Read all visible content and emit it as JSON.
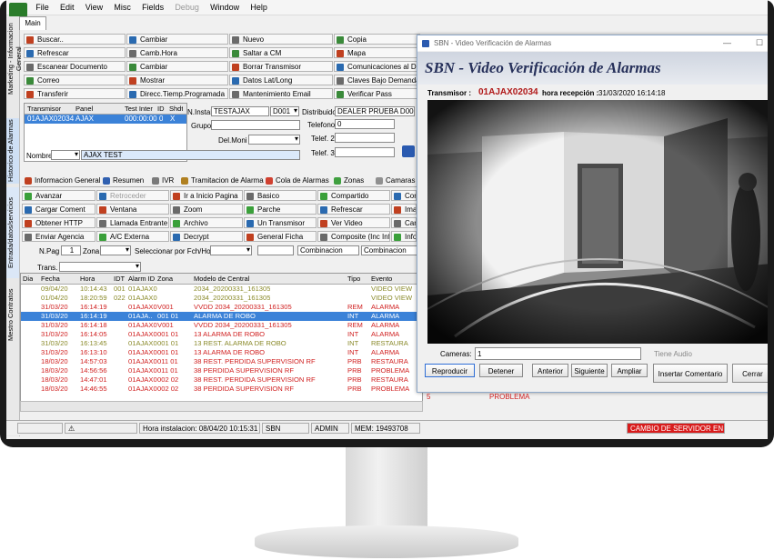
{
  "menu": {
    "items": [
      "File",
      "Edit",
      "View",
      "Misc",
      "Fields",
      "Debug",
      "Window",
      "Help"
    ],
    "disabled": [
      "Debug"
    ]
  },
  "main_tab": "Main",
  "vertical_tabs": [
    "Marketing - Informacion General",
    "Historico de Alarmas",
    "Entrada/datos/servicios",
    "Mestro Contratos"
  ],
  "toolbar": [
    [
      "Buscar..",
      "Cambiar",
      "Nuevo",
      "Copia"
    ],
    [
      "Refrescar",
      "Camb.Hora",
      "Saltar a CM",
      "Mapa"
    ],
    [
      "Escanear Documento",
      "Cambiar",
      "Borrar Transmisor",
      "Comunicaciones al Di"
    ],
    [
      "Correo",
      "Mostrar",
      "Datos Lat/Long",
      "Claves Bajo Demanda"
    ],
    [
      "Transferir",
      "Direcc.Tiemp.Programada",
      "Mantenimiento Email",
      "Verificar Pass"
    ]
  ],
  "transmitter_grid": {
    "headers": [
      "Transmisor",
      "Panel",
      "Test Inter",
      "ID",
      "Shdt"
    ],
    "row": [
      "01AJAX02034",
      "AJAX",
      "000:00:00",
      "0",
      "X"
    ]
  },
  "form": {
    "n_instal_label": "N.Instal",
    "n_instal_value": "TESTAJAX",
    "d_value": "D001",
    "distribuidor_label": "Distribuidor",
    "distribuidor_value": "DEALER PRUEBA D0001",
    "grupo_label": "Grupo",
    "telefono_label": "Telefono",
    "telefono_value": "0",
    "delmon_label": "Del.Moni",
    "telef2_label": "Telef. 2",
    "telef3_label": "Telef. 3",
    "nombre_label": "Nombre",
    "nombre_value": "AJAX TEST"
  },
  "subtabs": [
    "Informacion General",
    "Resumen",
    "IVR",
    "Tramitacion de Alarma",
    "Cola de Alarmas",
    "Zonas",
    "Camaras"
  ],
  "actions": [
    [
      "Avanzar",
      "Retroceder",
      "Ir a Inicio Pagina",
      "Basico",
      "Compartido",
      "Con"
    ],
    [
      "Cargar Coment",
      "Ventana",
      "Zoom",
      "Parche",
      "Refrescar",
      "Ima"
    ],
    [
      "Obtener HTTP",
      "Llamada Entrante",
      "Archivo",
      "Un Transmisor",
      "Ver Video",
      "Can"
    ],
    [
      "Enviar Agencia",
      "A/C Externa",
      "Decrypt",
      "General Ficha",
      "Composite (Inc Info)",
      "Info"
    ]
  ],
  "filters": {
    "npag_label": "N.Pag",
    "npag_value": "1",
    "zona_label": "Zona",
    "sel_fch_label": "Seleccionar por Fch/Hor",
    "combinacion1": "Combinacion",
    "combinacion2": "Combinacion",
    "trans_label": "Trans."
  },
  "events": {
    "headers": [
      "Dia",
      "Fecha",
      "Hora",
      "IDT",
      "Alarm ID",
      "Zona",
      "Modelo de Central",
      "Tipo",
      "Evento"
    ],
    "rows": [
      {
        "fecha": "09/04/20",
        "hora": "10:14:43",
        "idt": "001",
        "alarm": "01AJAX0",
        "zona": "",
        "modelo": "2034_20200331_161305",
        "tipo": "",
        "evento": "VIDEO VIEW",
        "color": "#8a8a2a"
      },
      {
        "fecha": "01/04/20",
        "hora": "18:20:59",
        "idt": "022",
        "alarm": "01AJAX0",
        "zona": "",
        "modelo": "2034_20200331_161305",
        "tipo": "",
        "evento": "VIDEO VIEW",
        "color": "#8a8a2a"
      },
      {
        "fecha": "31/03/20",
        "hora": "16:14:19",
        "idt": "",
        "alarm": "01AJAX0",
        "zona": "V001",
        "modelo": "VVDD 2034_20200331_161305",
        "tipo": "REM",
        "evento": "ALARMA",
        "color": "#d02020"
      },
      {
        "fecha": "31/03/20",
        "hora": "16:14:19",
        "idt": "",
        "alarm": "01AJA..",
        "zona": "001 01",
        "modelo": "ALARMA DE ROBO",
        "tipo": "INT",
        "evento": "ALARMA",
        "color": "#ffffff",
        "selected": true
      },
      {
        "fecha": "31/03/20",
        "hora": "16:14:18",
        "idt": "",
        "alarm": "01AJAX0",
        "zona": "V001",
        "modelo": "VVDD 2034_20200331_161305",
        "tipo": "REM",
        "evento": "ALARMA",
        "color": "#d02020"
      },
      {
        "fecha": "31/03/20",
        "hora": "16:14:05",
        "idt": "",
        "alarm": "01AJAX0",
        "zona": "001 01",
        "modelo": "13 ALARMA DE ROBO",
        "tipo": "INT",
        "evento": "ALARMA",
        "color": "#d02020"
      },
      {
        "fecha": "31/03/20",
        "hora": "16:13:45",
        "idt": "",
        "alarm": "01AJAX0",
        "zona": "001 01",
        "modelo": "13 REST. ALARMA DE ROBO",
        "tipo": "INT",
        "evento": "RESTAURA",
        "color": "#8a8a2a"
      },
      {
        "fecha": "31/03/20",
        "hora": "16:13:10",
        "idt": "",
        "alarm": "01AJAX0",
        "zona": "001 01",
        "modelo": "13 ALARMA DE ROBO",
        "tipo": "INT",
        "evento": "ALARMA",
        "color": "#d02020"
      },
      {
        "fecha": "18/03/20",
        "hora": "14:57:03",
        "idt": "",
        "alarm": "01AJAX0",
        "zona": "011 01",
        "modelo": "38 REST. PERDIDA SUPERVISION RF",
        "tipo": "PRB",
        "evento": "RESTAURA",
        "color": "#d02020"
      },
      {
        "fecha": "18/03/20",
        "hora": "14:56:56",
        "idt": "",
        "alarm": "01AJAX0",
        "zona": "011 01",
        "modelo": "38 PERDIDA SUPERVISION RF",
        "tipo": "PRB",
        "evento": "PROBLEMA",
        "color": "#d02020"
      },
      {
        "fecha": "18/03/20",
        "hora": "14:47:01",
        "idt": "",
        "alarm": "01AJAX0",
        "zona": "002 02",
        "modelo": "38 REST. PERDIDA SUPERVISION RF",
        "tipo": "PRB",
        "evento": "RESTAURA",
        "color": "#d02020"
      },
      {
        "fecha": "18/03/20",
        "hora": "14:46:55",
        "idt": "",
        "alarm": "01AJAX0",
        "zona": "002 02",
        "modelo": "38 PERDIDA SUPERVISION RF",
        "tipo": "PRB",
        "evento": "PROBLEMA",
        "color": "#d02020"
      }
    ]
  },
  "statusbar": {
    "hora_instalacion": "Hora instalacion: 08/04/20 10:15:31",
    "sbn": "SBN",
    "admin": "ADMIN",
    "mem": "MEM: 19493708",
    "alert": "CAMBIO DE SERVIDOR EN PR"
  },
  "video_window": {
    "window_title": "SBN - Video Verificación de Alarmas",
    "title": "SBN - Video Verificación de Alarmas",
    "transmisor_label": "Transmisor :",
    "transmisor_value": "01AJAX02034",
    "hora_recepcion_label": "hora recepción :",
    "hora_recepcion_value": "31/03/2020 16:14:18",
    "cameras_label": "Cameras:",
    "cameras_value": "1",
    "audio_label": "Tiene Audio",
    "buttons": {
      "reproducir": "Reproducir",
      "detener": "Detener",
      "anterior": "Anterior",
      "siguiente": "Siguiente",
      "ampliar": "Ampliar",
      "comentario": "Insertar Comentario",
      "cerrar": "Cerrar"
    },
    "extra_values": {
      "five": "5",
      "problema": "PROBLEMA"
    }
  },
  "colors": {
    "selection": "#3b82d8",
    "alarm": "#d02020",
    "restore": "#8a8a2a",
    "alert_bg": "#d81c1c",
    "title_blue": "#26305a"
  }
}
